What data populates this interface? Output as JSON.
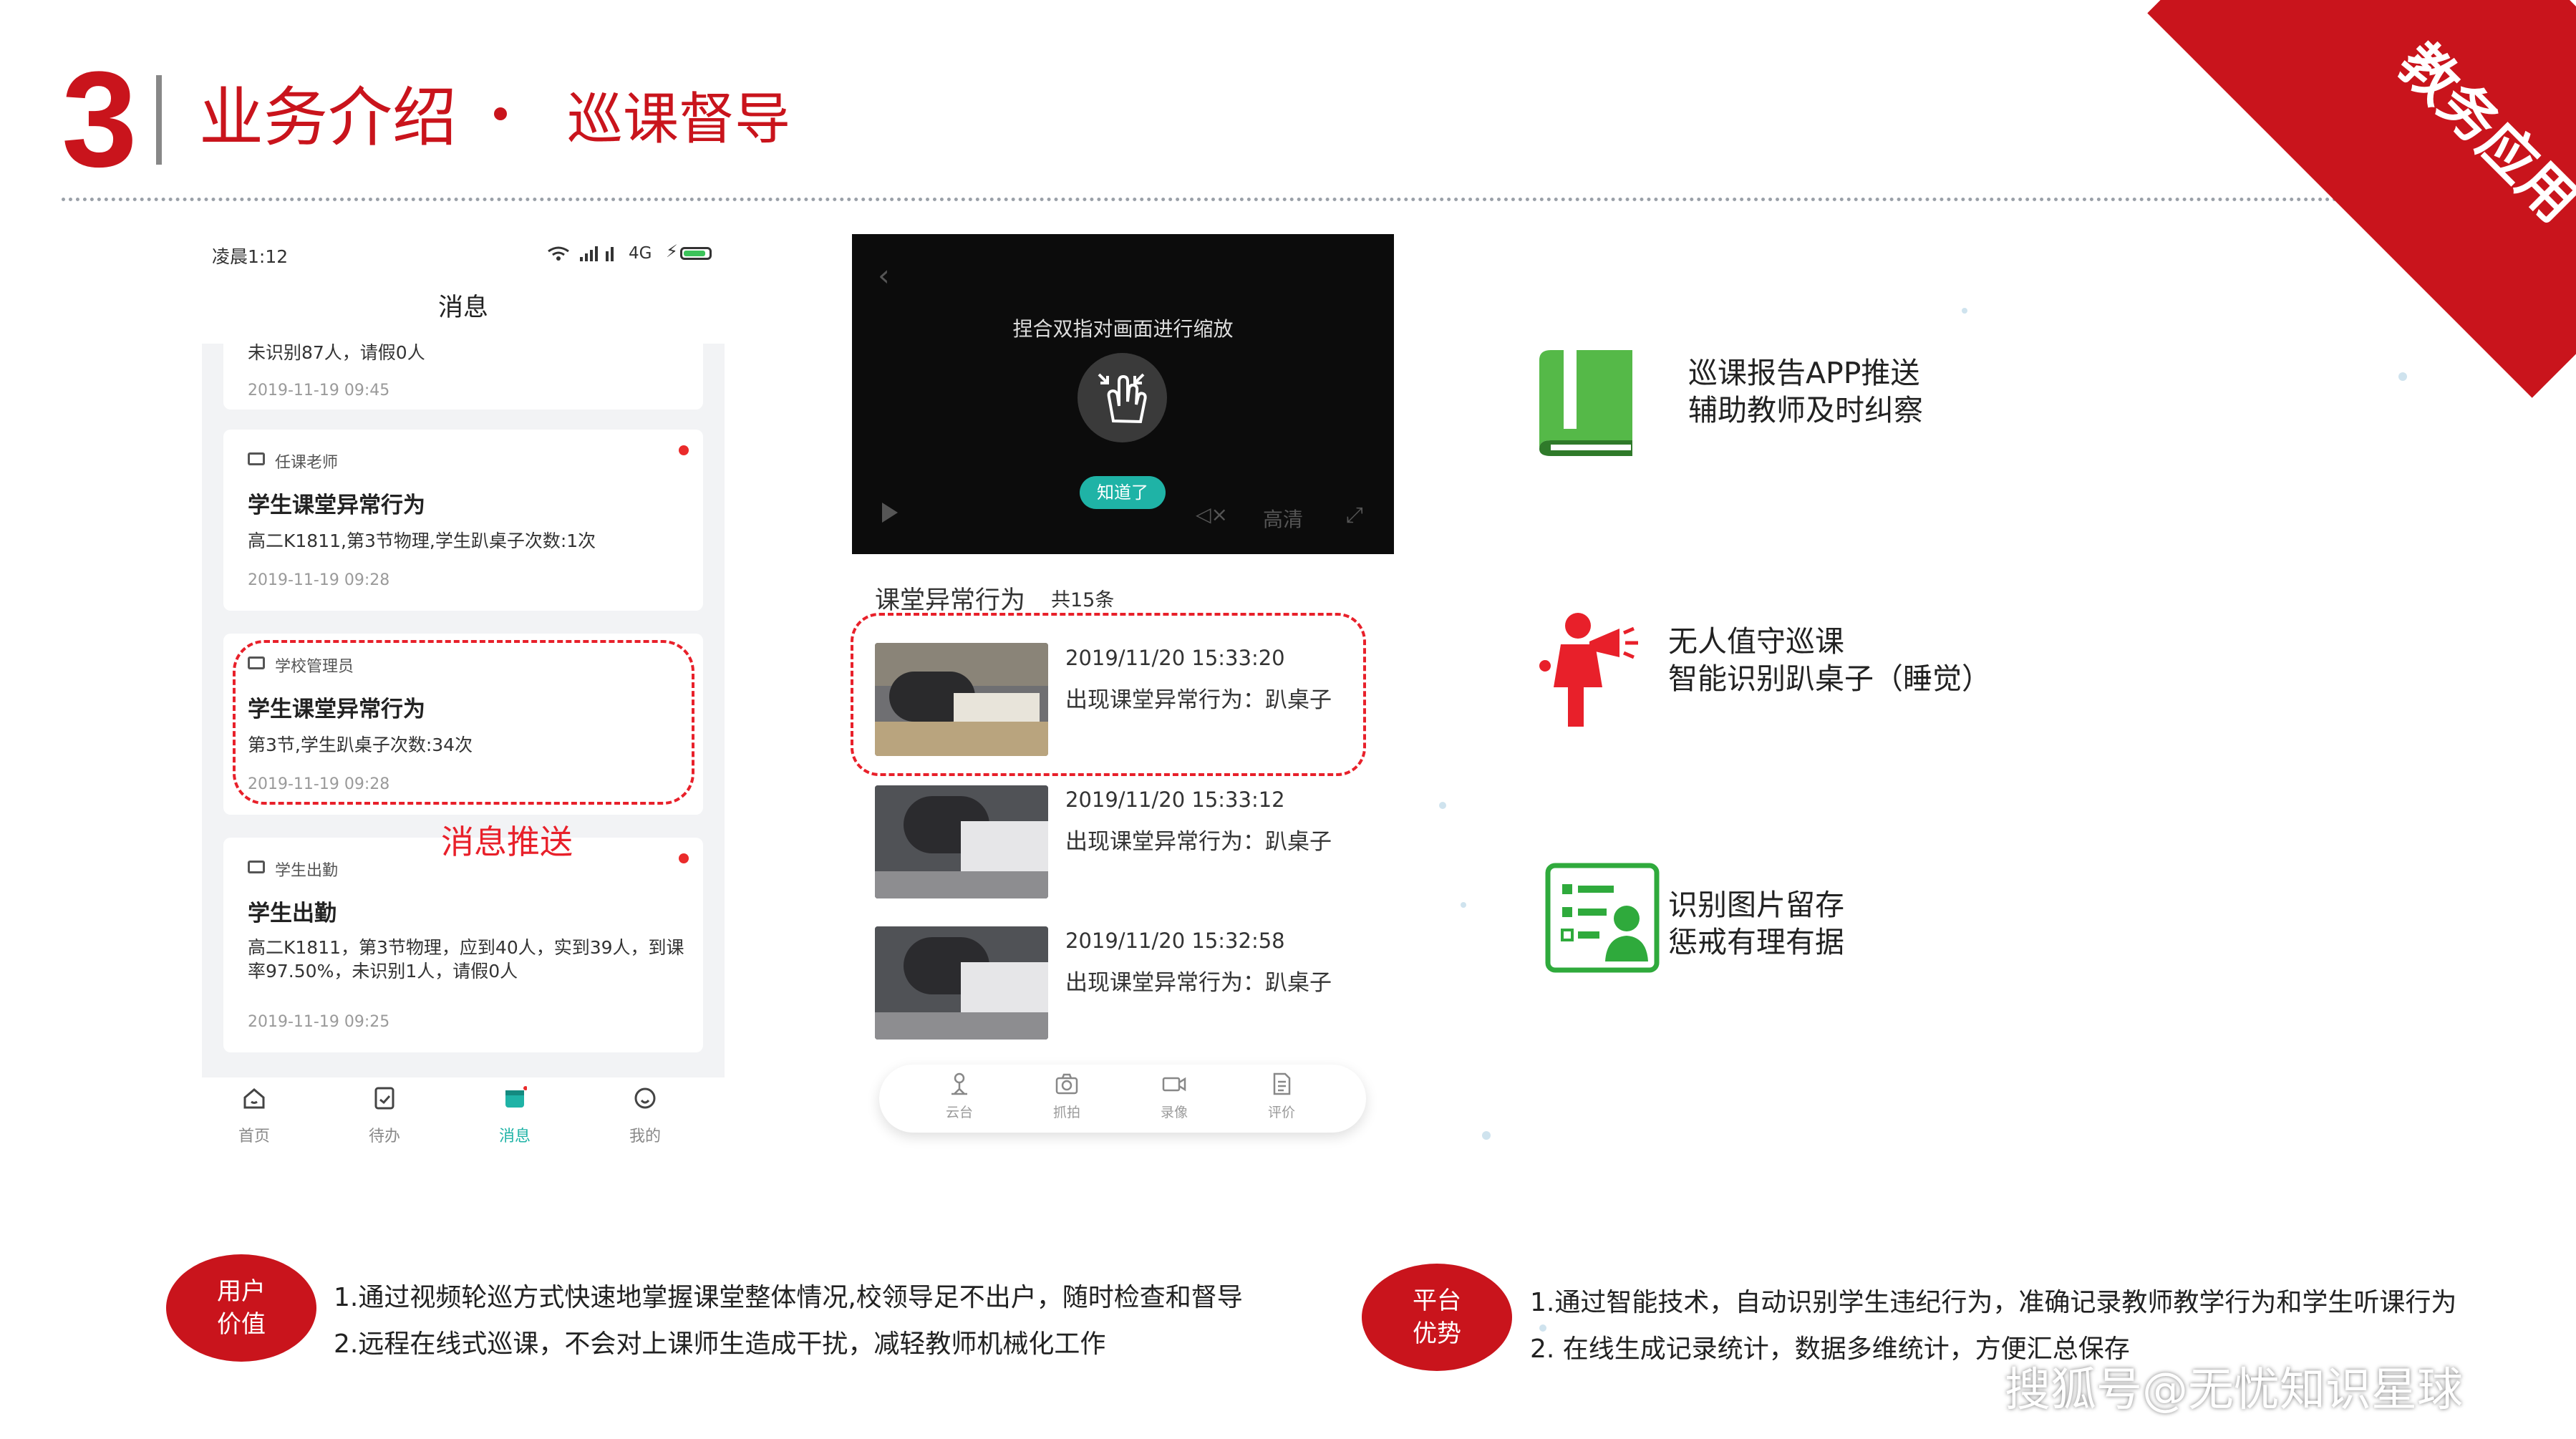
{
  "header": {
    "section_number": "3",
    "title": "业务介绍",
    "subtitle": "巡课督导",
    "corner_label": "教务应用"
  },
  "phone": {
    "status_time": "凌晨1:12",
    "status_signal": "4G",
    "title": "消息",
    "cards": [
      {
        "body": "未识别87人，请假0人",
        "date": "2019-11-19 09:45"
      },
      {
        "tag": "任课老师",
        "title": "学生课堂异常行为",
        "body": "高二K1811,第3节物理,学生趴桌子次数:1次",
        "date": "2019-11-19 09:28"
      },
      {
        "tag": "学校管理员",
        "title": "学生课堂异常行为",
        "body": "第3节,学生趴桌子次数:34次",
        "date": "2019-11-19 09:28"
      },
      {
        "tag": "学生出勤",
        "title": "学生出勤",
        "body": "高二K1811，第3节物理，应到40人，实到39人，到课率97.50%，未识别1人，请假0人",
        "date": "2019-11-19 09:25"
      }
    ],
    "tabs": [
      "首页",
      "待办",
      "消息",
      "我的"
    ],
    "push_label": "消息推送"
  },
  "video": {
    "hint": "捏合双指对画面进行缩放",
    "ok_button": "知道了",
    "quality": "高清"
  },
  "list": {
    "title": "课堂异常行为",
    "count": "共15条",
    "rows": [
      {
        "time": "2019/11/20 15:33:20",
        "text": "出现课堂异常行为：趴桌子"
      },
      {
        "time": "2019/11/20 15:33:12",
        "text": "出现课堂异常行为：趴桌子"
      },
      {
        "time": "2019/11/20 15:32:58",
        "text": "出现课堂异常行为：趴桌子"
      }
    ],
    "toolbar": [
      "云台",
      "抓拍",
      "录像",
      "评价"
    ]
  },
  "features": [
    {
      "icon": "book-icon",
      "line1": "巡课报告APP推送",
      "line2": "辅助教师及时纠察"
    },
    {
      "icon": "megaphone-person-icon",
      "line1": "无人值守巡课",
      "line2": "智能识别趴桌子（睡觉）"
    },
    {
      "icon": "id-card-icon",
      "line1": "识别图片留存",
      "line2": "惩戒有理有据"
    }
  ],
  "bottom": {
    "left_badge": [
      "用户",
      "价值"
    ],
    "left_lines": [
      "1.通过视频轮巡方式快速地掌握课堂整体情况,校领导足不出户，随时检查和督导",
      "2.远程在线式巡课，不会对上课师生造成干扰，减轻教师机械化工作"
    ],
    "right_badge": [
      "平台",
      "优势"
    ],
    "right_lines": [
      "1.通过智能技术，自动识别学生违纪行为，准确记录教师教学行为和学生听课行为",
      "2. 在线生成记录统计，数据多维统计，方便汇总保存"
    ]
  },
  "watermark": "搜狐号@无忧知识星球",
  "colors": {
    "brand_red": "#c9141c",
    "alert_red": "#e8202a",
    "teal": "#1fb3a6",
    "green": "#3cb43c"
  }
}
